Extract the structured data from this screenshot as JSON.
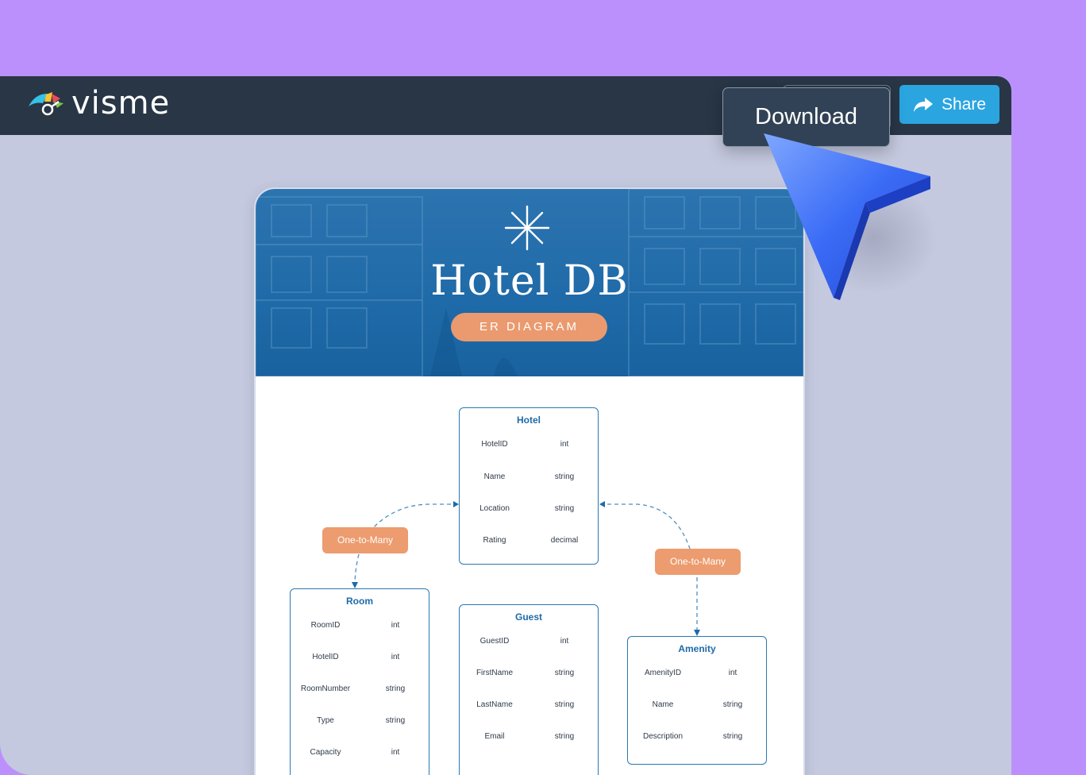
{
  "app": {
    "logo_text": "visme",
    "share_label": "Share",
    "download_label": "Download"
  },
  "document": {
    "title": "Hotel DB",
    "subtitle": "ER DIAGRAM"
  },
  "relationships": [
    {
      "label": "One-to-Many"
    },
    {
      "label": "One-to-Many"
    }
  ],
  "entities": [
    {
      "name": "Hotel",
      "fields": [
        {
          "name": "HotelID",
          "type": "int"
        },
        {
          "name": "Name",
          "type": "string"
        },
        {
          "name": "Location",
          "type": "string"
        },
        {
          "name": "Rating",
          "type": "decimal"
        }
      ]
    },
    {
      "name": "Room",
      "fields": [
        {
          "name": "RoomID",
          "type": "int"
        },
        {
          "name": "HotelID",
          "type": "int"
        },
        {
          "name": "RoomNumber",
          "type": "string"
        },
        {
          "name": "Type",
          "type": "string"
        },
        {
          "name": "Capacity",
          "type": "int"
        }
      ]
    },
    {
      "name": "Guest",
      "fields": [
        {
          "name": "GuestID",
          "type": "int"
        },
        {
          "name": "FirstName",
          "type": "string"
        },
        {
          "name": "LastName",
          "type": "string"
        },
        {
          "name": "Email",
          "type": "string"
        }
      ]
    },
    {
      "name": "Amenity",
      "fields": [
        {
          "name": "AmenityID",
          "type": "int"
        },
        {
          "name": "Name",
          "type": "string"
        },
        {
          "name": "Description",
          "type": "string"
        }
      ]
    }
  ],
  "colors": {
    "background": "#bb90fc",
    "topbar": "#283646",
    "share": "#2aa5e0",
    "hero": "#1f6aa8",
    "accent_orange": "#ec9c6e",
    "entity_border": "#2a78b0",
    "cursor": "#3b6cf6"
  },
  "icons": [
    "visme-logo-icon",
    "share-arrow-icon",
    "starburst-icon",
    "pointer-cursor-icon"
  ]
}
